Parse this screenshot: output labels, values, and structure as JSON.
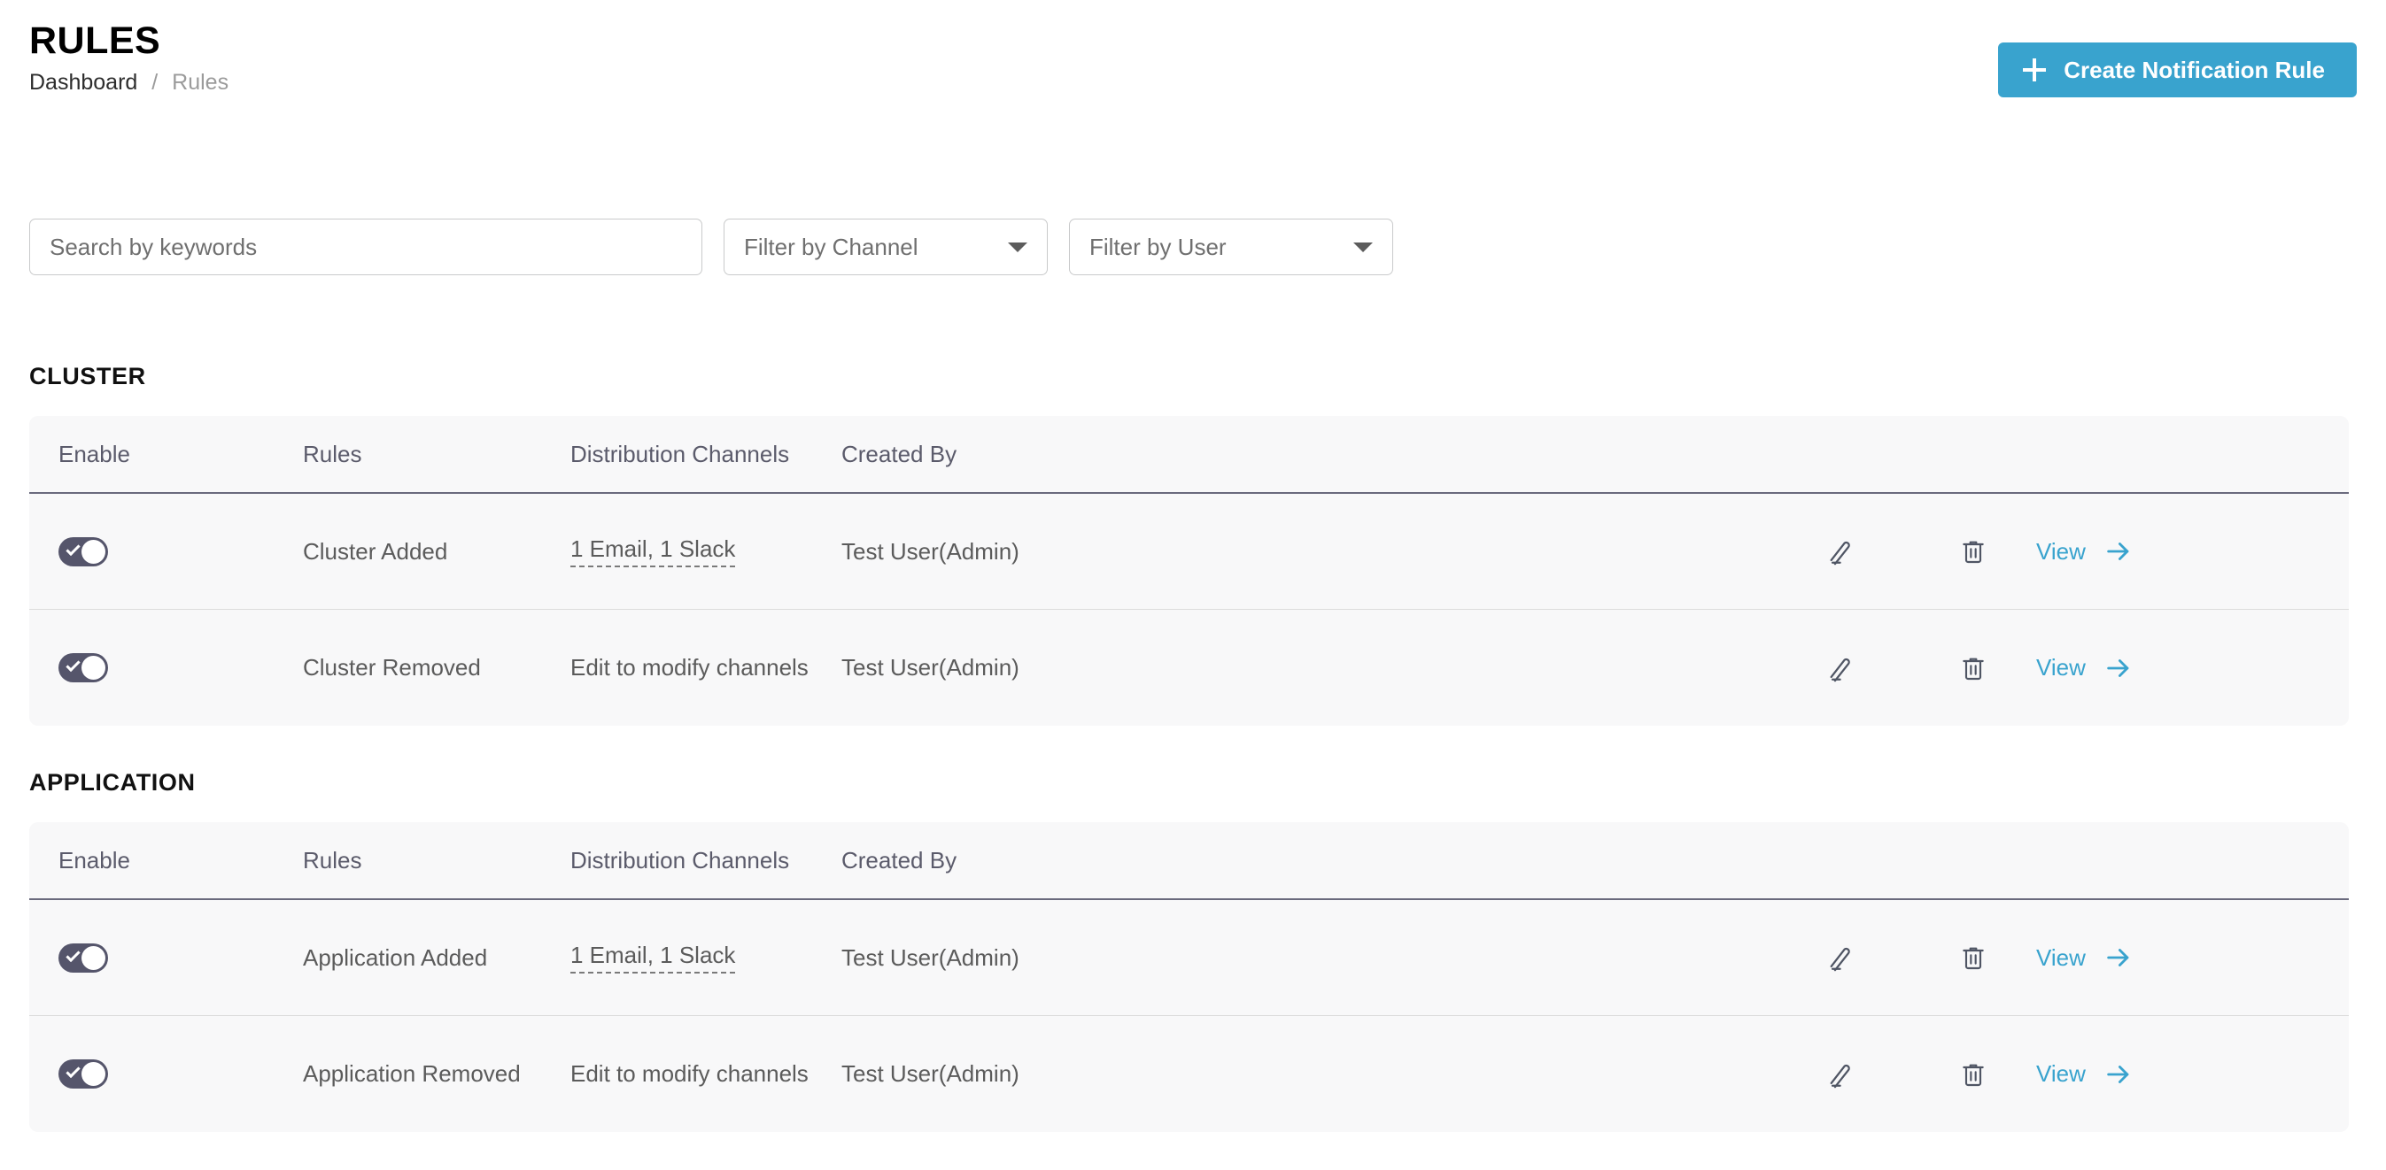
{
  "header": {
    "title": "RULES",
    "breadcrumb": {
      "parent": "Dashboard",
      "separator": "/",
      "current": "Rules"
    }
  },
  "toolbar": {
    "create_button_label": "Create Notification Rule",
    "create_button_icon": "plus-icon",
    "accent_color": "#39a3ce"
  },
  "filters": {
    "search_placeholder": "Search by keywords",
    "search_value": "",
    "channel_select_label": "Filter by Channel",
    "user_select_label": "Filter by User",
    "caret_icon": "chevron-down-icon"
  },
  "columns": {
    "enable": "Enable",
    "rules": "Rules",
    "channels": "Distribution Channels",
    "created_by": "Created By"
  },
  "row_actions": {
    "edit_icon": "pencil-icon",
    "delete_icon": "trash-icon",
    "view_label": "View",
    "view_arrow_icon": "arrow-right-icon",
    "toggle_icon": "check-icon",
    "toggle_on_color": "#55556b"
  },
  "sections": [
    {
      "title": "CLUSTER",
      "rows": [
        {
          "enabled": true,
          "rule": "Cluster Added",
          "channels": "1 Email, 1 Slack",
          "channels_has_tooltip": true,
          "created_by": "Test User(Admin)"
        },
        {
          "enabled": true,
          "rule": "Cluster Removed",
          "channels": "Edit to modify channels",
          "channels_has_tooltip": false,
          "created_by": "Test User(Admin)"
        }
      ]
    },
    {
      "title": "APPLICATION",
      "rows": [
        {
          "enabled": true,
          "rule": "Application Added",
          "channels": "1 Email, 1 Slack",
          "channels_has_tooltip": true,
          "created_by": "Test User(Admin)"
        },
        {
          "enabled": true,
          "rule": "Application Removed",
          "channels": "Edit to modify channels",
          "channels_has_tooltip": false,
          "created_by": "Test User(Admin)"
        }
      ]
    }
  ]
}
